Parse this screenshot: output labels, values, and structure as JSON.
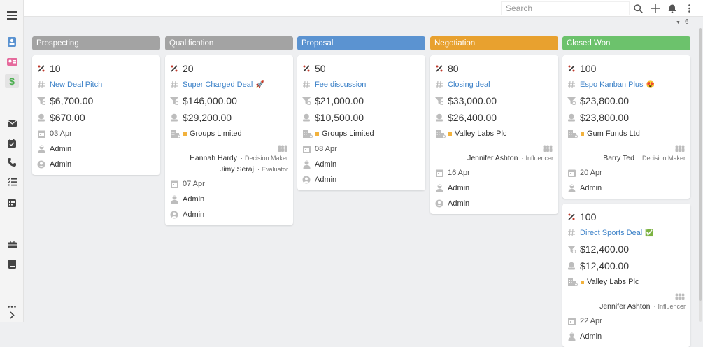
{
  "search": {
    "placeholder": "Search"
  },
  "kanban": {
    "count": "6"
  },
  "colors": {
    "prospecting": "#a3a3a3",
    "qualification": "#a3a3a3",
    "proposal": "#5b93d1",
    "negotiation": "#e8a12f",
    "closed_won": "#6cc26c",
    "link": "#3d82c8",
    "badge": "#f2b23d"
  },
  "columns": [
    {
      "title": "Prospecting",
      "cards": [
        {
          "probability": "10",
          "name": "New Deal Pitch",
          "amount": "$6,700.00",
          "weighted": "$670.00",
          "date": "03 Apr",
          "user1": "Admin",
          "user2": "Admin"
        }
      ]
    },
    {
      "title": "Qualification",
      "cards": [
        {
          "probability": "20",
          "name": "Super Charged Deal",
          "emoji": "🚀",
          "amount": "$146,000.00",
          "weighted": "$29,200.00",
          "account": "Groups Limited",
          "contacts": [
            {
              "name": "Hannah Hardy",
              "role": "Decision Maker"
            },
            {
              "name": "Jimy Seraj",
              "role": "Evaluator"
            }
          ],
          "date": "07 Apr",
          "user1": "Admin",
          "user2": "Admin"
        }
      ]
    },
    {
      "title": "Proposal",
      "cards": [
        {
          "probability": "50",
          "name": "Fee discussion",
          "amount": "$21,000.00",
          "weighted": "$10,500.00",
          "account": "Groups Limited",
          "date": "08 Apr",
          "user1": "Admin",
          "user2": "Admin"
        }
      ]
    },
    {
      "title": "Negotiation",
      "cards": [
        {
          "probability": "80",
          "name": "Closing deal",
          "amount": "$33,000.00",
          "weighted": "$26,400.00",
          "account": "Valley Labs Plc",
          "contacts": [
            {
              "name": "Jennifer Ashton",
              "role": "Influencer"
            }
          ],
          "date": "16 Apr",
          "user1": "Admin",
          "user2": "Admin"
        }
      ]
    },
    {
      "title": "Closed Won",
      "cards": [
        {
          "probability": "100",
          "name": "Espo Kanban Plus",
          "emoji": "😍",
          "amount": "$23,800.00",
          "weighted": "$23,800.00",
          "account": "Gum Funds Ltd",
          "contacts": [
            {
              "name": "Barry Ted",
              "role": "Decision Maker"
            }
          ],
          "date": "20 Apr",
          "user1": "Admin"
        },
        {
          "probability": "100",
          "name": "Direct Sports Deal",
          "emoji": "✅",
          "amount": "$12,400.00",
          "weighted": "$12,400.00",
          "account": "Valley Labs Plc",
          "contacts": [
            {
              "name": "Jennifer Ashton",
              "role": "Influencer"
            }
          ],
          "date": "22 Apr",
          "user1": "Admin"
        }
      ]
    }
  ]
}
